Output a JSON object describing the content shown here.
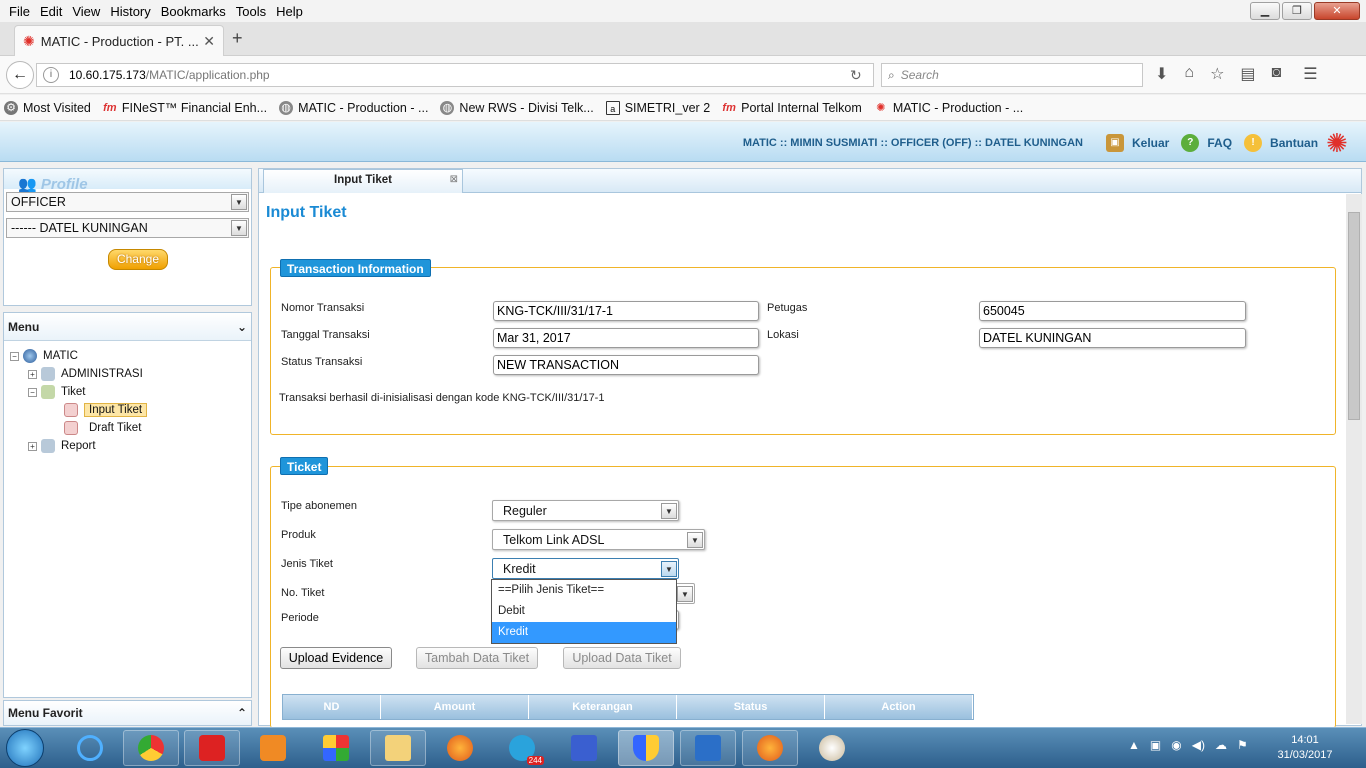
{
  "browser": {
    "menu": [
      "File",
      "Edit",
      "View",
      "History",
      "Bookmarks",
      "Tools",
      "Help"
    ],
    "tab_title": "MATIC - Production - PT. ...",
    "url_host": "10.60.175.173",
    "url_path": "/MATIC/application.php",
    "search_placeholder": "Search",
    "bookmarks": [
      "Most Visited",
      "FINeST™ Financial Enh...",
      "MATIC - Production - ...",
      "New RWS - Divisi Telk...",
      "SIMETRI_ver 2",
      "Portal Internal Telkom",
      "MATIC - Production - ..."
    ]
  },
  "app_header": {
    "user_info": "MATIC :: MIMIN SUSMIATI :: OFFICER (OFF) :: DATEL KUNINGAN",
    "keluar": "Keluar",
    "faq": "FAQ",
    "bantuan": "Bantuan"
  },
  "profile": {
    "title": "Profile",
    "role": "OFFICER",
    "unit": "------ DATEL KUNINGAN",
    "change_label": "Change"
  },
  "menu": {
    "title": "Menu",
    "root": "MATIC",
    "items": {
      "administrasi": "ADMINISTRASI",
      "tiket": "Tiket",
      "input_tiket": "Input Tiket",
      "draft_tiket": "Draft Tiket",
      "report": "Report"
    },
    "favorit_title": "Menu Favorit"
  },
  "content": {
    "tab_label": "Input Tiket",
    "page_title": "Input Tiket",
    "transaction": {
      "legend": "Transaction Information",
      "nomor_label": "Nomor Transaksi",
      "nomor_value": "KNG-TCK/III/31/17-1",
      "tanggal_label": "Tanggal Transaksi",
      "tanggal_value": "Mar 31, 2017",
      "status_label": "Status Transaksi",
      "status_value": "NEW TRANSACTION",
      "petugas_label": "Petugas",
      "petugas_value": "650045",
      "lokasi_label": "Lokasi",
      "lokasi_value": "DATEL KUNINGAN",
      "message": "Transaksi berhasil di-inisialisasi dengan kode KNG-TCK/III/31/17-1"
    },
    "ticket": {
      "legend": "Ticket",
      "tipe_label": "Tipe abonemen",
      "tipe_value": "Reguler",
      "produk_label": "Produk",
      "produk_value": "Telkom Link ADSL",
      "jenis_label": "Jenis Tiket",
      "jenis_value": "Kredit",
      "jenis_options": [
        "==Pilih Jenis Tiket==",
        "Debit",
        "Kredit"
      ],
      "no_label": "No. Tiket",
      "periode_label": "Periode",
      "upload_evidence": "Upload Evidence",
      "tambah_data": "Tambah Data Tiket",
      "upload_data": "Upload Data Tiket"
    },
    "grid_headers": [
      "ND",
      "Amount",
      "Keterangan",
      "Status",
      "Action"
    ]
  },
  "taskbar": {
    "time": "14:01",
    "date": "31/03/2017",
    "badge": "244"
  },
  "colors": {
    "accent": "#1a8ad4",
    "legend_bg": "#1f95da",
    "fieldset_border": "#f0b429",
    "selected_option": "#3399ff"
  }
}
